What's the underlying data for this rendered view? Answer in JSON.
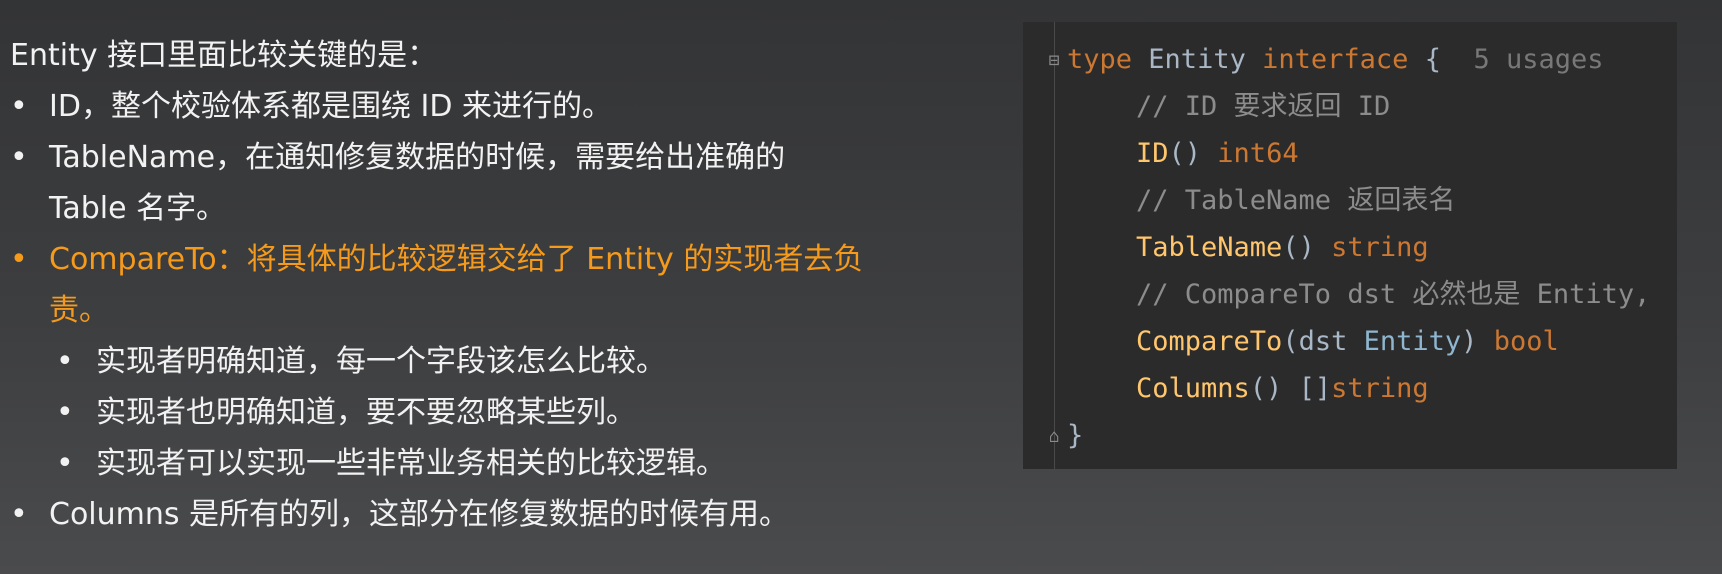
{
  "slide": {
    "intro": "Entity 接口里面比较关键的是：",
    "bullets": [
      {
        "text": "ID，整个校验体系都是围绕 ID 来进行的。"
      },
      {
        "text": "TableName，在通知修复数据的时候，需要给出准确的 Table 名字。"
      },
      {
        "text": "CompareTo：将具体的比较逻辑交给了 Entity 的实现者去负责。",
        "sub": [
          "实现者明确知道，每一个字段该怎么比较。",
          "实现者也明确知道，要不要忽略某些列。",
          "实现者可以实现一些非常业务相关的比较逻辑。"
        ]
      },
      {
        "text": "Columns 是所有的列，这部分在修复数据的时候有用。"
      }
    ],
    "highlight_color": "#f59a1b"
  },
  "code": {
    "line1": {
      "kw_type": "type",
      "name": "Entity",
      "kw_interface": "interface",
      "brace": "{",
      "usages": "5 usages"
    },
    "line2": {
      "comment": "// ID 要求返回 ID"
    },
    "line3": {
      "method": "ID",
      "parens": "()",
      "ret": "int64"
    },
    "line4": {
      "comment": "// TableName 返回表名"
    },
    "line5": {
      "method": "TableName",
      "parens": "()",
      "ret": "string"
    },
    "line6": {
      "comment": "// CompareTo dst 必然也是 Entity,"
    },
    "line7": {
      "method": "CompareTo",
      "open": "(",
      "param": "dst",
      "ptype": "Entity",
      "close": ")",
      "ret": "bool"
    },
    "line8": {
      "method": "Columns",
      "parens": "()",
      "slice": "[]",
      "ret": "string"
    },
    "line9": {
      "brace": "}"
    }
  },
  "icons": {
    "fold_open": "fold-collapse-icon",
    "fold_close": "fold-end-icon"
  }
}
